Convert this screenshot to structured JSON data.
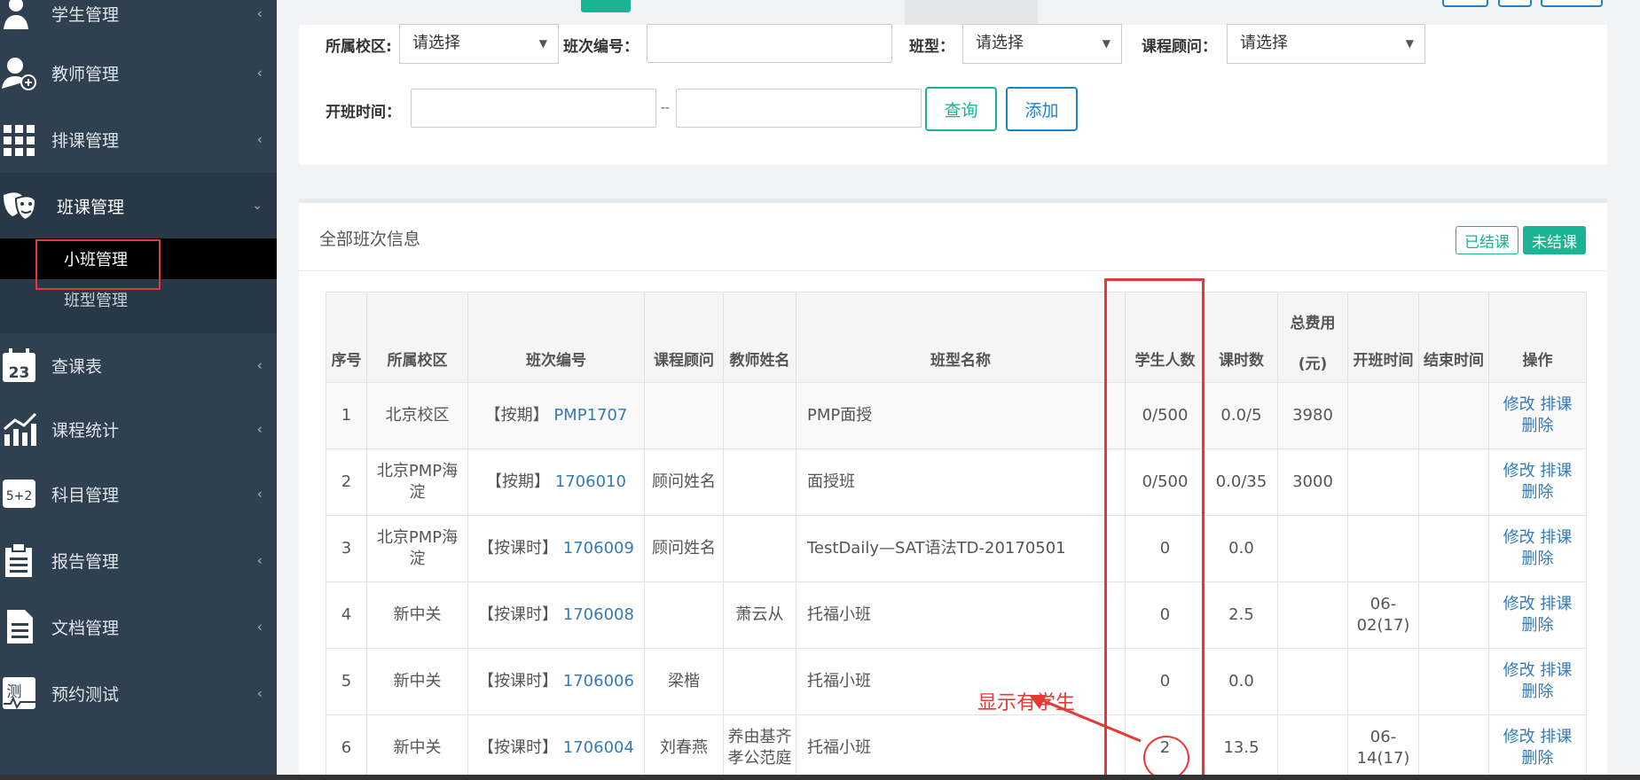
{
  "sidebar": {
    "items": [
      {
        "label": "学生管理",
        "icon": "students-icon"
      },
      {
        "label": "教师管理",
        "icon": "teacher-icon"
      },
      {
        "label": "排课管理",
        "icon": "grid-icon"
      },
      {
        "label": "班课管理",
        "icon": "theater-masks-icon"
      },
      {
        "label": "查课表",
        "icon": "calendar-icon"
      },
      {
        "label": "课程统计",
        "icon": "chart-icon"
      },
      {
        "label": "科目管理",
        "icon": "math-icon"
      },
      {
        "label": "报告管理",
        "icon": "clipboard-icon"
      },
      {
        "label": "文档管理",
        "icon": "document-icon"
      },
      {
        "label": "预约测试",
        "icon": "test-icon"
      }
    ],
    "calendar_day": "23",
    "test_icon_char": "测",
    "math_icon_text": "5+2",
    "submenu": [
      {
        "label": "小班管理"
      },
      {
        "label": "班型管理"
      }
    ]
  },
  "filters": {
    "campus_label": "所属校区:",
    "campus_value": "请选择",
    "class_no_label": "班次编号：",
    "class_type_label": "班型：",
    "class_type_value": "请选择",
    "advisor_label": "课程顾问：",
    "advisor_value": "请选择",
    "start_time_label": "开班时间：",
    "range_sep": "--",
    "query_button": "查询",
    "add_button": "添加"
  },
  "panel": {
    "title": "全部班次信息",
    "tag_finished": "已结课",
    "tag_unfinished": "未结课"
  },
  "table": {
    "headers": [
      "序号",
      "所属校区",
      "班次编号",
      "课程顾问",
      "教师姓名",
      "班型名称",
      "学生人数",
      "课时数",
      "总费用(元)",
      "开班时间",
      "结束时间",
      "操作"
    ],
    "header_fee_line1": "总费用",
    "header_fee_line2": "(元)",
    "ops": {
      "edit": "修改",
      "schedule": "排课",
      "delete": "删除"
    },
    "rows": [
      {
        "no": "1",
        "campus": "北京校区",
        "prefix": "【按期】",
        "code": "PMP1707",
        "advisor": "",
        "teacher": "",
        "type": "PMP面授",
        "students": "0/500",
        "hours": "0.0/5",
        "fee": "3980",
        "start": "",
        "end": ""
      },
      {
        "no": "2",
        "campus": "北京PMP海淀",
        "prefix": "【按期】",
        "code": "1706010",
        "advisor": "顾问姓名",
        "teacher": "",
        "type": "面授班",
        "students": "0/500",
        "hours": "0.0/35",
        "fee": "3000",
        "start": "",
        "end": ""
      },
      {
        "no": "3",
        "campus": "北京PMP海淀",
        "prefix": "【按课时】",
        "code": "1706009",
        "advisor": "顾问姓名",
        "teacher": "",
        "type": "TestDaily—SAT语法TD-20170501",
        "students": "0",
        "hours": "0.0",
        "fee": "",
        "start": "",
        "end": ""
      },
      {
        "no": "4",
        "campus": "新中关",
        "prefix": "【按课时】",
        "code": "1706008",
        "advisor": "",
        "teacher": "萧云从",
        "type": "托福小班",
        "students": "0",
        "hours": "2.5",
        "fee": "",
        "start": "06-02(17)",
        "end": ""
      },
      {
        "no": "5",
        "campus": "新中关",
        "prefix": "【按课时】",
        "code": "1706006",
        "advisor": "梁楷",
        "teacher": "",
        "type": "托福小班",
        "students": "0",
        "hours": "0.0",
        "fee": "",
        "start": "",
        "end": ""
      },
      {
        "no": "6",
        "campus": "新中关",
        "prefix": "【按课时】",
        "code": "1706004",
        "advisor": "刘春燕",
        "teacher": "养由基齐孝公范庭",
        "type": "托福小班",
        "students": "2",
        "hours": "13.5",
        "fee": "",
        "start": "06-14(17)",
        "end": ""
      }
    ]
  },
  "annotation": {
    "text": "显示有学生",
    "color": "#e53935"
  },
  "colors": {
    "sidebar_bg": "#2f4050",
    "accent_green": "#1ab394",
    "accent_blue": "#1c84c6",
    "link_blue": "#337ab7"
  }
}
